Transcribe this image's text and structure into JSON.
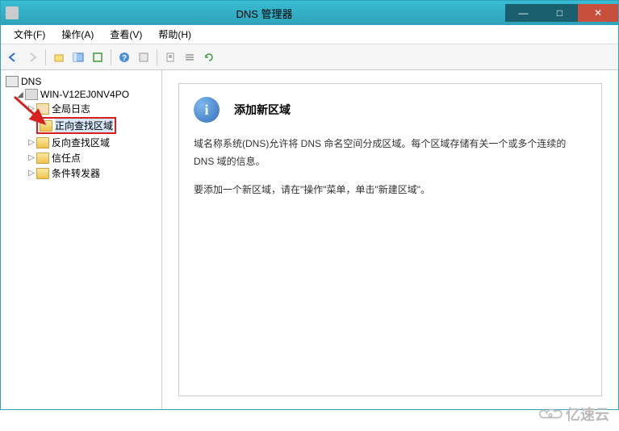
{
  "window": {
    "title": "DNS 管理器"
  },
  "menu": {
    "file": "文件(F)",
    "action": "操作(A)",
    "view": "查看(V)",
    "help": "帮助(H)"
  },
  "tree": {
    "root": "DNS",
    "server": "WIN-V12EJ0NV4PO",
    "global_log": "全局日志",
    "forward_zone": "正向查找区域",
    "reverse_zone": "反向查找区域",
    "trust_points": "信任点",
    "conditional_fwd": "条件转发器"
  },
  "detail": {
    "heading": "添加新区域",
    "para1": "域名称系统(DNS)允许将 DNS 命名空间分成区域。每个区域存储有关一个或多个连续的 DNS 域的信息。",
    "para2": "要添加一个新区域，请在\"操作\"菜单，单击\"新建区域\"。"
  },
  "watermark": {
    "text": "亿速云"
  }
}
